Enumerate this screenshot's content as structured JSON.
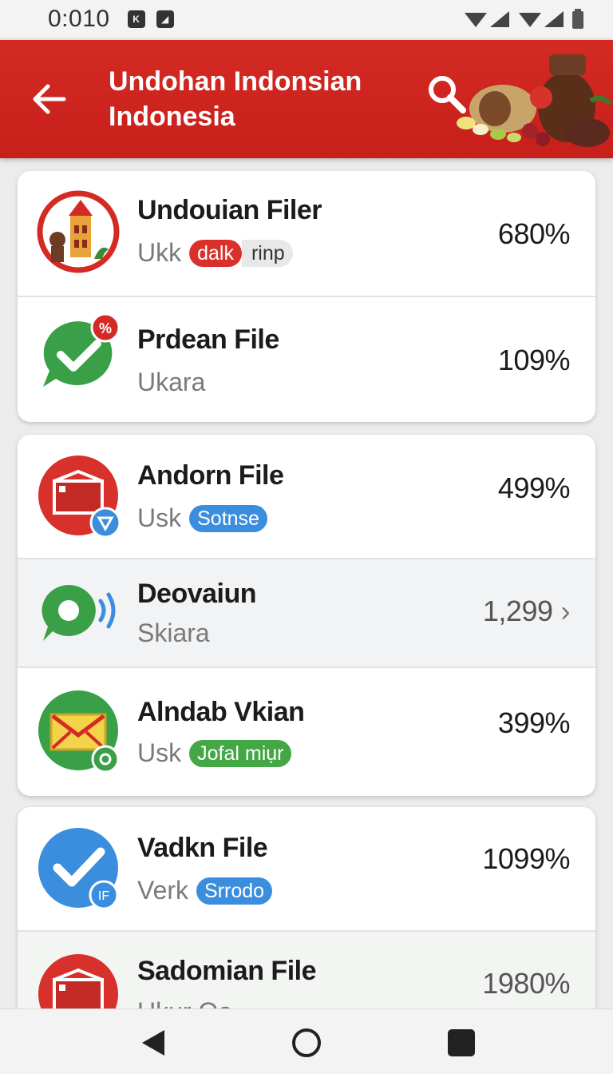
{
  "status_bar": {
    "time": "0:010",
    "notif_1": "K",
    "notif_2": "◢"
  },
  "app_bar": {
    "title": "Undohan Indonsian Indonesia",
    "back_icon": "arrow-left-icon",
    "search_icon": "search-icon",
    "color": "#d42a24"
  },
  "cards": [
    {
      "rows": [
        {
          "title": "Undouian Filer",
          "sub": "Ukk",
          "badge_red": "dalk",
          "badge_gray": "rinp",
          "value": "680%",
          "icon": "temple-icon"
        },
        {
          "title": "Prdean File",
          "sub": "Ukara",
          "value": "109%",
          "icon": "chat-check-icon",
          "icon_badge": "%"
        }
      ]
    },
    {
      "rows": [
        {
          "title": "Andorn File",
          "sub": "Usk",
          "badge": "Sotnse",
          "value": "499%",
          "icon": "folder-icon"
        },
        {
          "title": "Deovaiun",
          "sub": "Skiara",
          "value": "1,299",
          "chevron": "›",
          "icon": "chat-wave-icon"
        },
        {
          "title": "Alndab Vkian",
          "sub": "Usk",
          "badge": "Jofal miụr",
          "value": "399%",
          "icon": "mail-icon"
        }
      ]
    },
    {
      "rows": [
        {
          "title": "Vadkn File",
          "sub": "Verk",
          "badge": "Srrodo",
          "value": "1099%",
          "icon": "check-circle-icon",
          "icon_badge": "IF"
        },
        {
          "title": "Sadomian File",
          "sub": "Ukur Oo",
          "value": "1980%",
          "icon": "folder-icon"
        }
      ]
    }
  ],
  "nav_bar": {
    "back": "back-triangle-icon",
    "home": "home-circle-icon",
    "recents": "recents-square-icon"
  }
}
